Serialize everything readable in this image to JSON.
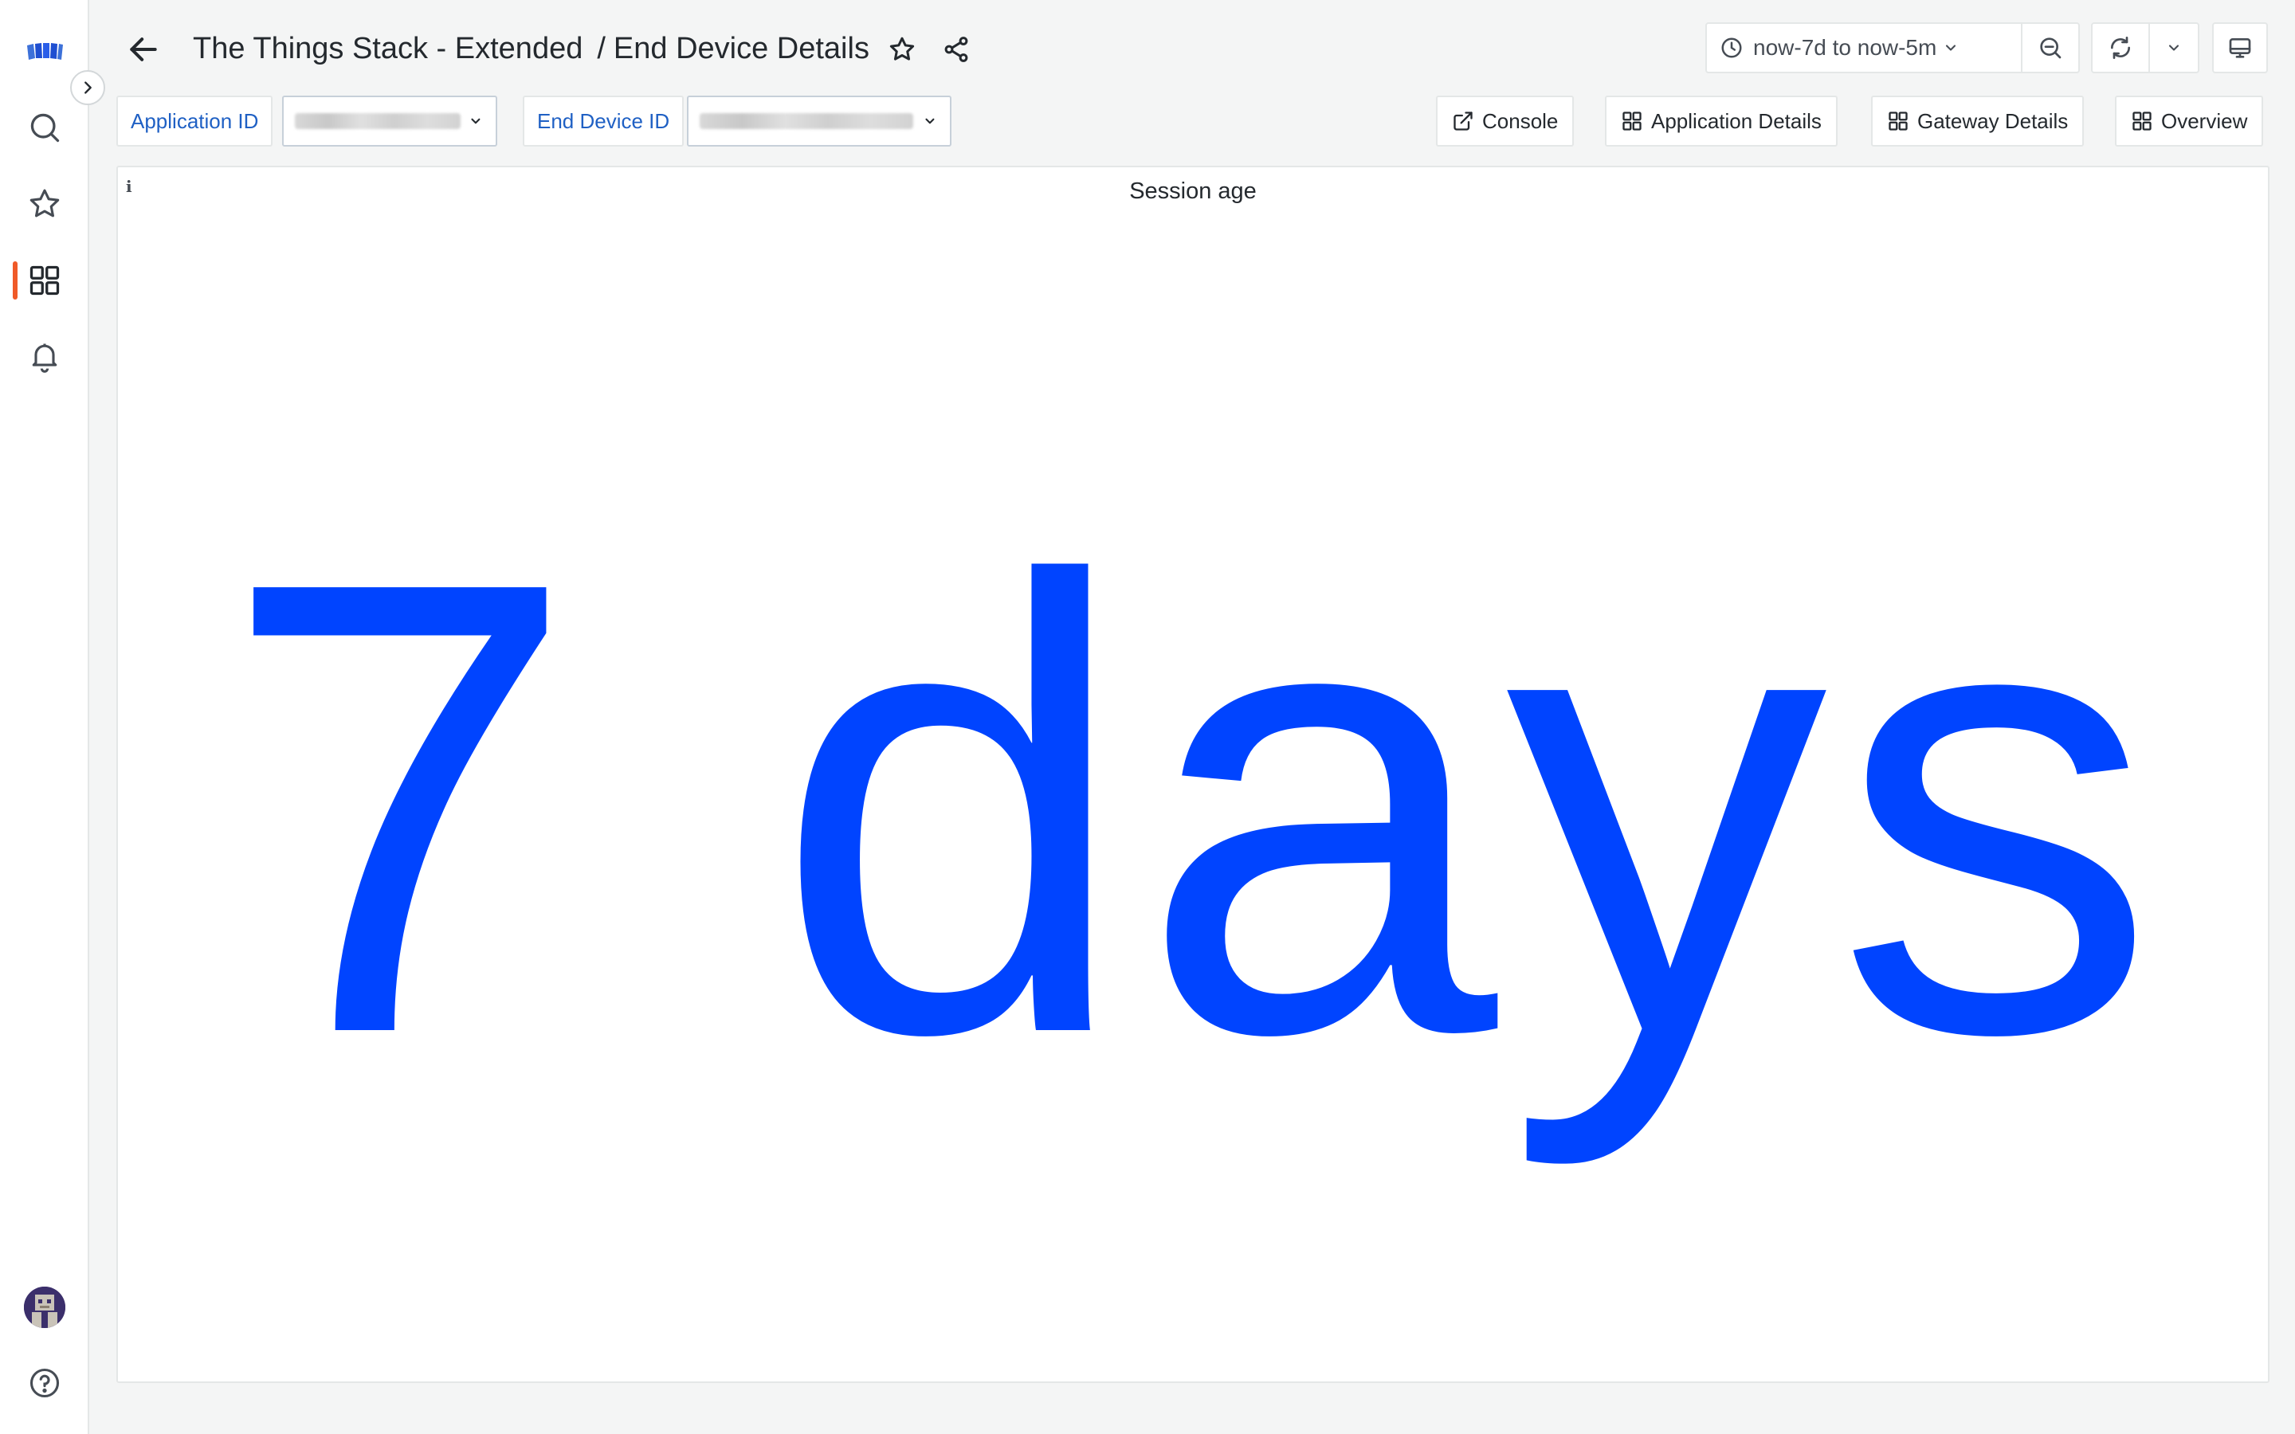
{
  "header": {
    "title_folder": "The Things Stack - Extended",
    "title_separator": "/",
    "title_dashboard": "End Device Details"
  },
  "timepicker": {
    "range": "now-7d to now-5m"
  },
  "variables": {
    "application_id_label": "Application ID",
    "end_device_id_label": "End Device ID"
  },
  "links": {
    "console": "Console",
    "application_details": "Application Details",
    "gateway_details": "Gateway Details",
    "overview": "Overview"
  },
  "panel": {
    "title": "Session age",
    "info_glyph": "i",
    "value": "7 days"
  },
  "colors": {
    "accent_active": "#f05a28",
    "value": "#0044ff",
    "variable_label": "#1f60c4"
  },
  "icons": {
    "sidebar": [
      "logo-icon",
      "search-icon",
      "star-icon",
      "dashboards-icon",
      "bell-icon",
      "avatar",
      "help-icon"
    ],
    "header": [
      "arrow-left-icon",
      "star-icon",
      "share-icon",
      "clock-icon",
      "zoom-out-icon",
      "refresh-icon",
      "tv-icon"
    ]
  }
}
